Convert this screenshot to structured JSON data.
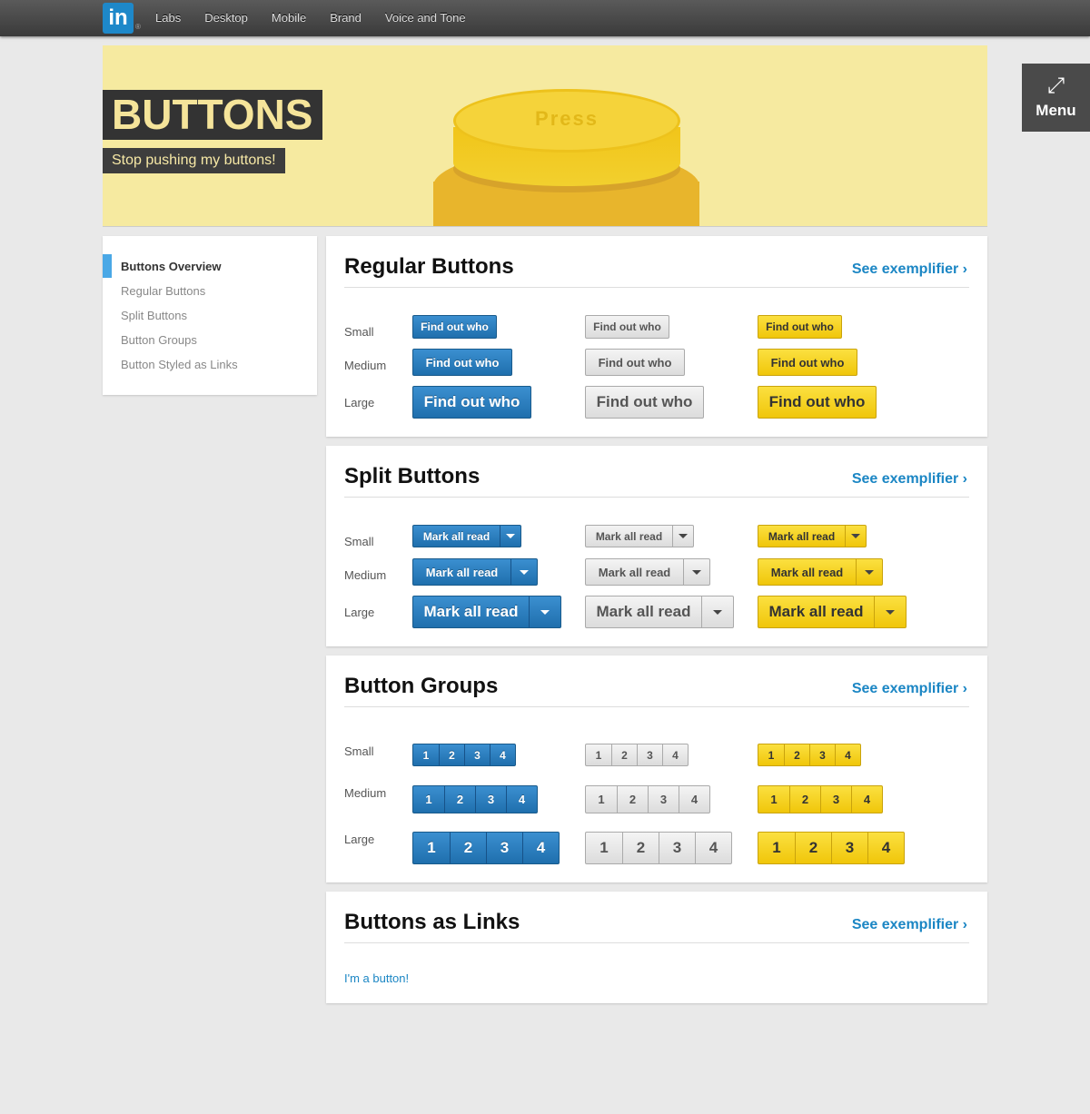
{
  "nav": {
    "logo": "in",
    "logo_mark": "®",
    "items": [
      "Labs",
      "Desktop",
      "Mobile",
      "Brand",
      "Voice and Tone"
    ]
  },
  "hero": {
    "title": "BUTTONS",
    "subtitle": "Stop pushing my buttons!",
    "button_label": "Press"
  },
  "menu": {
    "icon": "expand-arrows-icon",
    "label": "Menu"
  },
  "sidebar": {
    "items": [
      {
        "label": "Buttons Overview",
        "active": true
      },
      {
        "label": "Regular Buttons"
      },
      {
        "label": "Split Buttons"
      },
      {
        "label": "Button Groups"
      },
      {
        "label": "Button Styled as Links"
      }
    ]
  },
  "sizes": {
    "small": "Small",
    "medium": "Medium",
    "large": "Large"
  },
  "sections": {
    "regular": {
      "title": "Regular Buttons",
      "link": "See exemplifier ›",
      "button_label": "Find out who"
    },
    "split": {
      "title": "Split Buttons",
      "link": "See exemplifier ›",
      "button_label": "Mark all read"
    },
    "groups": {
      "title": "Button Groups",
      "link": "See exemplifier ›",
      "labels": [
        "1",
        "2",
        "3",
        "4"
      ]
    },
    "links": {
      "title": "Buttons as Links",
      "link": "See exemplifier ›",
      "link_button": "I'm a button!"
    }
  },
  "colors": {
    "accent": "#1b86c4",
    "blue": "#2b7cc0",
    "yellow": "#f5d020",
    "grey": "#e6e6e6",
    "hero": "#f6eaa0"
  }
}
